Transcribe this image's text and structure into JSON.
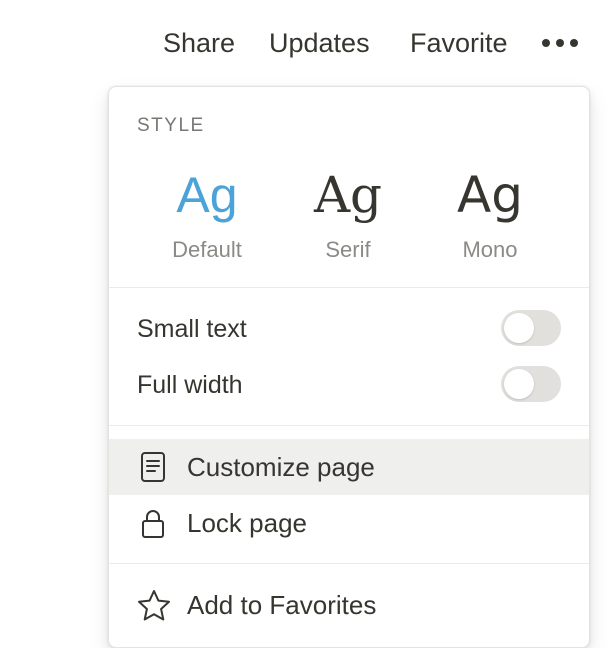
{
  "topbar": {
    "share_label": "Share",
    "updates_label": "Updates",
    "favorite_label": "Favorite",
    "more_icon": "more-horizontal-icon"
  },
  "menu": {
    "style_section_label": "STYLE",
    "styles": [
      {
        "sample": "Ag",
        "name": "Default",
        "selected": true
      },
      {
        "sample": "Ag",
        "name": "Serif",
        "selected": false
      },
      {
        "sample": "Ag",
        "name": "Mono",
        "selected": false
      }
    ],
    "toggles": [
      {
        "label": "Small text",
        "on": false
      },
      {
        "label": "Full width",
        "on": false
      }
    ],
    "actions": [
      {
        "label": "Customize page",
        "icon": "document-icon",
        "hovered": true
      },
      {
        "label": "Lock page",
        "icon": "lock-icon",
        "hovered": false
      },
      {
        "label": "Add to Favorites",
        "icon": "star-icon",
        "hovered": false
      }
    ]
  },
  "colors": {
    "selected_style_accent": "#4ba3d8",
    "text": "#37352f",
    "muted_text": "#8b8a86",
    "toggle_off": "#e1e0dc",
    "hover_row": "#efefee"
  }
}
